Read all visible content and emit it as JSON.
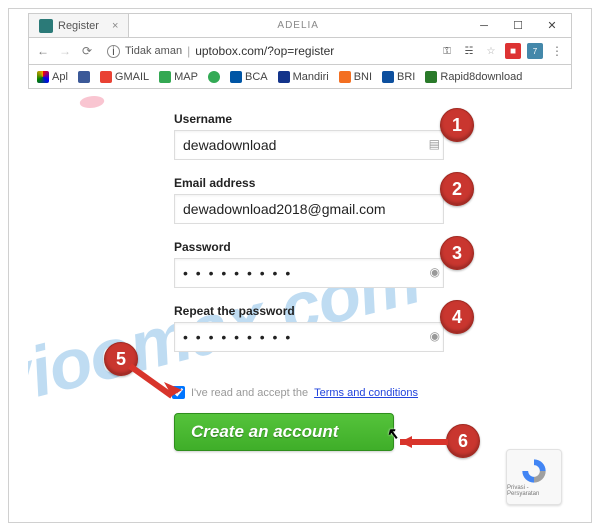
{
  "browser": {
    "tab_title": "Register",
    "title_center": "ADELIA",
    "insecure_label": "Tidak aman",
    "url": "uptobox.com/?op=register",
    "bookmarks": {
      "apl": "Apl",
      "gmail": "GMAIL",
      "map": "MAP",
      "bca": "BCA",
      "mandiri": "Mandiri",
      "bni": "BNI",
      "bri": "BRI",
      "rapid8": "Rapid8download"
    }
  },
  "form": {
    "username_label": "Username",
    "username_value": "dewadownload",
    "email_label": "Email address",
    "email_value": "dewadownload2018@gmail.com",
    "password_label": "Password",
    "password_value": "• • • • • • • • •",
    "repeat_label": "Repeat the password",
    "repeat_value": "• • • • • • • • •",
    "tc_text": "I've read and accept the ",
    "tc_link": "Terms and conditions",
    "button_label": "Create an account"
  },
  "badges": {
    "b1": "1",
    "b2": "2",
    "b3": "3",
    "b4": "4",
    "b5": "5",
    "b6": "6"
  },
  "watermark": "vioomax.com",
  "recaptcha": {
    "line1": "Privasi - Persyaratan"
  }
}
